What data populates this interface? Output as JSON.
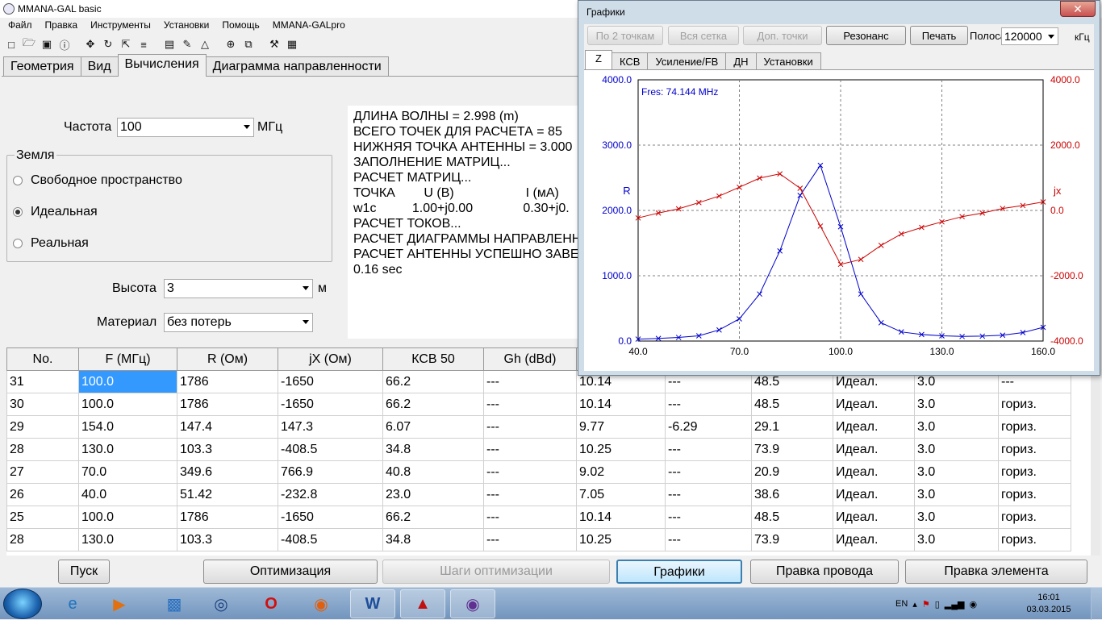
{
  "app": {
    "title": "MMANA-GAL basic"
  },
  "menu": [
    "Файл",
    "Правка",
    "Инструменты",
    "Установки",
    "Помощь",
    "MMANA-GALpro"
  ],
  "toolbar_icons": [
    "new-file-icon",
    "open-folder-icon",
    "save-icon",
    "info-icon",
    "move-icon",
    "rotate-icon",
    "scale-icon",
    "wire-tool-icon",
    "document-icon",
    "pencil-icon",
    "triangle-icon",
    "crosshair-icon",
    "copy-icon",
    "tools-icon",
    "calculator-icon"
  ],
  "tabs": [
    "Геометрия",
    "Вид",
    "Вычисления",
    "Диаграмма направленности"
  ],
  "calc": {
    "freq_label": "Частота",
    "freq_value": "100",
    "freq_unit": "МГц",
    "ground_title": "Земля",
    "ground_options": [
      "Свободное пространство",
      "Идеальная",
      "Реальная"
    ],
    "ground_selected": "Идеальная",
    "height_label": "Высота",
    "height_value": "3",
    "height_unit": "м",
    "material_label": "Материал",
    "material_value": "без потерь"
  },
  "log": {
    "lines": [
      "ДЛИНА ВОЛНЫ = 2.998 (m)",
      "ВСЕГО ТОЧЕК ДЛЯ РАСЧЕТА = 85",
      "НИЖНЯЯ ТОЧКА АНТЕННЫ = 3.000",
      "ЗАПОЛНЕНИЕ МАТРИЦ...",
      "РАСЧЕТ МАТРИЦ...",
      "ТОЧКА        U (В)                    I (мА)",
      "w1c          1.00+j0.00              0.30+j0.",
      "РАСЧЕТ ТОКОВ...",
      "РАСЧЕТ ДИАГРАММЫ НАПРАВЛЕНН",
      "РАСЧЕТ АНТЕННЫ УСПЕШНО ЗАВЕ",
      "0.16 sec"
    ]
  },
  "table": {
    "headers": [
      "No.",
      "F (МГц)",
      "R (Ом)",
      "jX (Ом)",
      "КСВ 50",
      "Gh (dBd)",
      "",
      "",
      "",
      "",
      "",
      ""
    ],
    "rows": [
      [
        "31",
        "100.0",
        "1786",
        "-1650",
        "66.2",
        "---",
        "10.14",
        "---",
        "48.5",
        "Идеал.",
        "3.0",
        "---"
      ],
      [
        "30",
        "100.0",
        "1786",
        "-1650",
        "66.2",
        "---",
        "10.14",
        "---",
        "48.5",
        "Идеал.",
        "3.0",
        "гориз."
      ],
      [
        "29",
        "154.0",
        "147.4",
        "147.3",
        "6.07",
        "---",
        "9.77",
        "-6.29",
        "29.1",
        "Идеал.",
        "3.0",
        "гориз."
      ],
      [
        "28",
        "130.0",
        "103.3",
        "-408.5",
        "34.8",
        "---",
        "10.25",
        "---",
        "73.9",
        "Идеал.",
        "3.0",
        "гориз."
      ],
      [
        "27",
        "70.0",
        "349.6",
        "766.9",
        "40.8",
        "---",
        "9.02",
        "---",
        "20.9",
        "Идеал.",
        "3.0",
        "гориз."
      ],
      [
        "26",
        "40.0",
        "51.42",
        "-232.8",
        "23.0",
        "---",
        "7.05",
        "---",
        "38.6",
        "Идеал.",
        "3.0",
        "гориз."
      ],
      [
        "25",
        "100.0",
        "1786",
        "-1650",
        "66.2",
        "---",
        "10.14",
        "---",
        "48.5",
        "Идеал.",
        "3.0",
        "гориз."
      ],
      [
        "28",
        "130.0",
        "103.3",
        "-408.5",
        "34.8",
        "---",
        "10.25",
        "---",
        "73.9",
        "Идеал.",
        "3.0",
        "гориз."
      ]
    ],
    "selected": {
      "row": 0,
      "col": 1
    }
  },
  "bottom_buttons": {
    "start": "Пуск",
    "optimize": "Оптимизация",
    "opt_steps": "Шаги оптимизации",
    "graphs": "Графики",
    "edit_wire": "Правка провода",
    "edit_element": "Правка элемента"
  },
  "graphs": {
    "title": "Графики",
    "buttons": [
      "По 2 точкам",
      "Вся сетка",
      "Доп. точки",
      "Резонанс",
      "Печать"
    ],
    "band_label": "Полоса",
    "band_value": "120000",
    "band_unit": "кГц",
    "tabs": [
      "Z",
      "КСВ",
      "Усиление/FB",
      "ДН",
      "Установки"
    ],
    "active_tab": "Z"
  },
  "chart_data": {
    "type": "line",
    "annotation": "Fres: 74.144 MHz",
    "xlim": [
      40.0,
      160.0
    ],
    "x_ticks": [
      "40.0",
      "70.0",
      "100.0",
      "130.0",
      "160.0"
    ],
    "y_left_label": "R",
    "y_right_label": "jx",
    "y_left_ticks": [
      "0.0",
      "1000.0",
      "2000.0",
      "3000.0",
      "4000.0"
    ],
    "y_right_ticks": [
      "-4000.0",
      "-2000.0",
      "0.0",
      "2000.0",
      "4000.0"
    ],
    "ylim_left": [
      0,
      4000
    ],
    "ylim_right": [
      -4000,
      4000
    ],
    "grid": true,
    "series": [
      {
        "name": "R",
        "axis": "left",
        "color": "#0000cc",
        "x": [
          40,
          46,
          52,
          58,
          64,
          70,
          76,
          82,
          88,
          94,
          100,
          106,
          112,
          118,
          124,
          130,
          136,
          142,
          148,
          154,
          160
        ],
        "y": [
          30,
          40,
          55,
          80,
          170,
          340,
          720,
          1380,
          2230,
          2690,
          1750,
          720,
          280,
          140,
          100,
          80,
          70,
          75,
          90,
          130,
          210
        ]
      },
      {
        "name": "jx",
        "axis": "right",
        "color": "#cc0000",
        "x": [
          40,
          46,
          52,
          58,
          64,
          70,
          76,
          82,
          88,
          94,
          100,
          106,
          112,
          118,
          124,
          130,
          136,
          142,
          148,
          154,
          160
        ],
        "y": [
          -230,
          -80,
          50,
          240,
          440,
          710,
          990,
          1120,
          680,
          -480,
          -1650,
          -1500,
          -1070,
          -720,
          -520,
          -350,
          -190,
          -80,
          60,
          150,
          260
        ]
      }
    ]
  },
  "taskbar": {
    "lang": "EN",
    "time": "16:01",
    "date": "03.03.2015",
    "apps": [
      "ie-icon",
      "media-player-icon",
      "network-drive-icon",
      "remote-desktop-icon",
      "opera-icon",
      "firefox-icon",
      "word-icon",
      "acrobat-icon",
      "mmana-icon"
    ]
  },
  "colors": {
    "r_series": "#0000cc",
    "jx_series": "#cc0000",
    "grid": "#808080",
    "selection": "#3399ff"
  }
}
